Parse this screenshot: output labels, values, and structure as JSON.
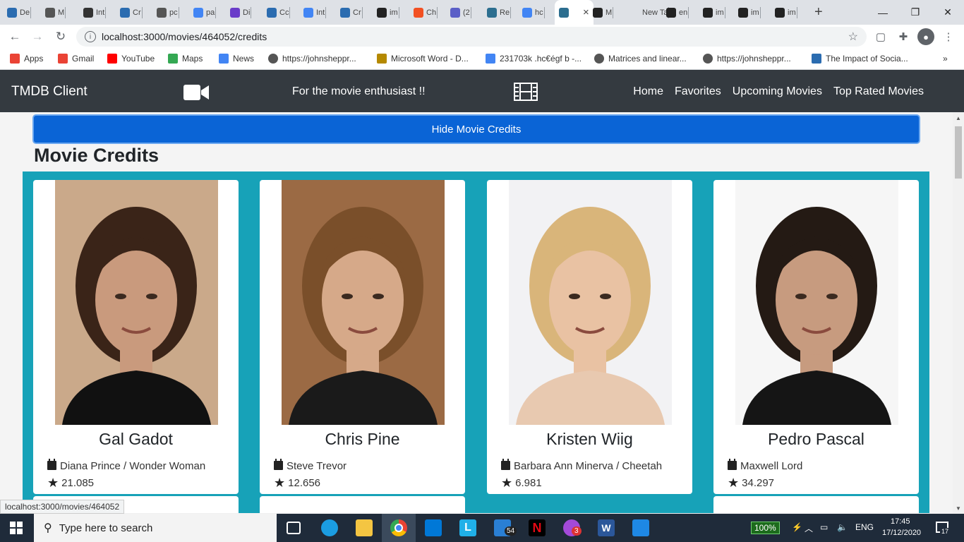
{
  "browser": {
    "tabs": [
      {
        "label": "De",
        "color": "#2b6cb0"
      },
      {
        "label": "M",
        "color": "#555"
      },
      {
        "label": "Int",
        "color": "#333"
      },
      {
        "label": "Cr",
        "color": "#2b6cb0"
      },
      {
        "label": "pc",
        "color": "#555"
      },
      {
        "label": "pa",
        "color": "#4285f4"
      },
      {
        "label": "Di",
        "color": "#6a3cc9"
      },
      {
        "label": "Cc",
        "color": "#2b6cb0"
      },
      {
        "label": "Int",
        "color": "#4285f4"
      },
      {
        "label": "Cr",
        "color": "#2b6cb0"
      },
      {
        "label": "im",
        "color": "#222"
      },
      {
        "label": "Ch",
        "color": "#f25022"
      },
      {
        "label": "(2",
        "color": "#5b5fc7"
      },
      {
        "label": "Re",
        "color": "#2c6e8f"
      },
      {
        "label": "hc",
        "color": "#4285f4"
      },
      {
        "label": "",
        "color": "#2c6e8f"
      },
      {
        "label": "M",
        "color": "#222"
      },
      {
        "label": "New Ta",
        "color": "#dee1e6"
      },
      {
        "label": "en",
        "color": "#222"
      },
      {
        "label": "im",
        "color": "#222"
      },
      {
        "label": "im",
        "color": "#222"
      },
      {
        "label": "im",
        "color": "#222"
      }
    ],
    "tab_close": "×",
    "new_tab": "+",
    "url": "localhost:3000/movies/464052/credits",
    "bookmarks": [
      {
        "label": "Apps",
        "color": "#ea4335"
      },
      {
        "label": "Gmail",
        "color": "#ea4335"
      },
      {
        "label": "YouTube",
        "color": "#ff0000"
      },
      {
        "label": "Maps",
        "color": "#34a853"
      },
      {
        "label": "News",
        "color": "#4285f4"
      },
      {
        "label": "https://johnsheppr...",
        "color": "#555"
      },
      {
        "label": "Microsoft Word - D...",
        "color": "#b58900"
      },
      {
        "label": "231703k .hc€égf b -...",
        "color": "#4285f4"
      },
      {
        "label": "Matrices and linear...",
        "color": "#555"
      },
      {
        "label": "https://johnsheppr...",
        "color": "#555"
      },
      {
        "label": "The Impact of Socia...",
        "color": "#2b6cb0"
      }
    ],
    "status_url": "localhost:3000/movies/464052"
  },
  "navbar": {
    "brand": "TMDB Client",
    "tagline": "For the movie enthusiast !!",
    "links": [
      "Home",
      "Favorites",
      "Upcoming Movies",
      "Top Rated Movies"
    ]
  },
  "page": {
    "toggle_button": "Hide Movie Credits",
    "title": "Movie Credits"
  },
  "credits": [
    {
      "name": "Gal Gadot",
      "character": "Diana Prince / Wonder Woman",
      "popularity": "21.085",
      "bg": "#caa98a",
      "hair": "#3a2418",
      "skin": "#c99a7d",
      "shirt": "#111"
    },
    {
      "name": "Chris Pine",
      "character": "Steve Trevor",
      "popularity": "12.656",
      "bg": "#9b6a44",
      "hair": "#7a4f2a",
      "skin": "#d6a989",
      "shirt": "#1a1a1a"
    },
    {
      "name": "Kristen Wiig",
      "character": "Barbara Ann Minerva / Cheetah",
      "popularity": "6.981",
      "bg": "#f2f2f4",
      "hair": "#d9b57a",
      "skin": "#e9c2a3",
      "shirt": "#e8c9b0"
    },
    {
      "name": "Pedro Pascal",
      "character": "Maxwell Lord",
      "popularity": "34.297",
      "bg": "#f6f6f6",
      "hair": "#241a14",
      "skin": "#c79b7f",
      "shirt": "#151515"
    }
  ],
  "taskbar": {
    "search_placeholder": "Type here to search",
    "battery": "100%",
    "language": "ENG",
    "time": "17:45",
    "date": "17/12/2020",
    "mail_badge": "54",
    "notif_badge": "3",
    "action_center_badge": "17"
  }
}
